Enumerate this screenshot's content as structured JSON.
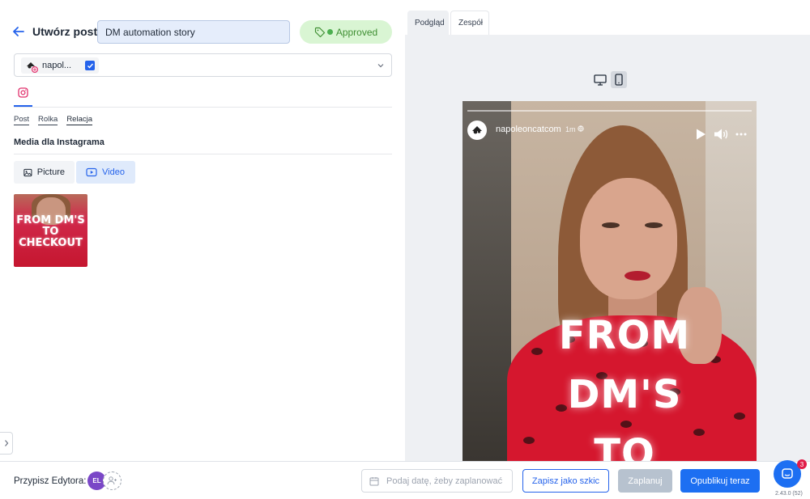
{
  "header": {
    "title": "Utwórz post",
    "post_name": "DM automation story",
    "status": "Approved"
  },
  "account": {
    "name": "napol...",
    "checked": true
  },
  "network_tab": "instagram-icon",
  "subtabs": [
    "Post",
    "Rolka",
    "Relacja"
  ],
  "media": {
    "heading": "Media dla Instagrama",
    "picture_label": "Picture",
    "video_label": "Video",
    "thumbnail_text": "FROM DM'S TO CHECKOUT"
  },
  "preview": {
    "tabs": [
      "Podgląd",
      "Zespół"
    ],
    "username": "napoleoncatcom",
    "time": "1m",
    "overlay_text": [
      "FROM",
      "DM'S",
      "TO"
    ]
  },
  "footer": {
    "assign_label": "Przypisz Edytora:",
    "editor_initials": "EL",
    "date_placeholder": "Podaj datę, żeby zaplanować",
    "draft_label": "Zapisz jako szkic",
    "schedule_label": "Zaplanuj",
    "publish_label": "Opublikuj teraz",
    "chat_badge": "3",
    "version": "2.43.0 (52)"
  },
  "colors": {
    "accent": "#1d6ff2",
    "approved_bg": "#d9f5d3",
    "approved_text": "#3f8f33"
  }
}
